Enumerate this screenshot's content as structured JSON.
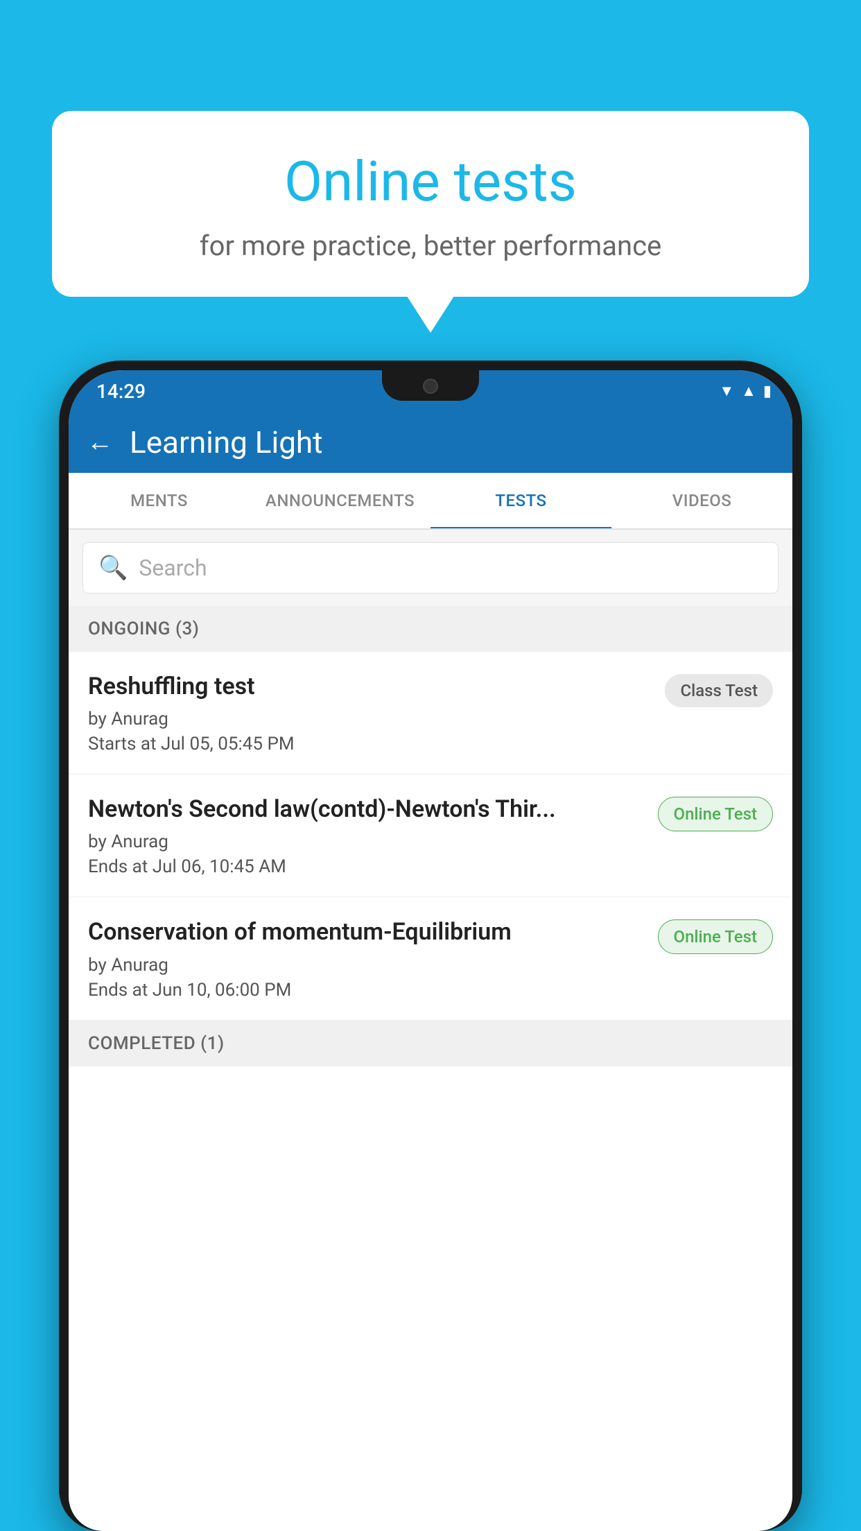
{
  "background_color": "#1bb8e8",
  "speech_bubble": {
    "title": "Online tests",
    "subtitle": "for more practice, better performance"
  },
  "phone": {
    "status_bar": {
      "time": "14:29",
      "icons": [
        "wifi",
        "signal",
        "battery"
      ]
    },
    "header": {
      "back_label": "←",
      "title": "Learning Light"
    },
    "tabs": [
      {
        "label": "MENTS",
        "active": false
      },
      {
        "label": "ANNOUNCEMENTS",
        "active": false
      },
      {
        "label": "TESTS",
        "active": true
      },
      {
        "label": "VIDEOS",
        "active": false
      }
    ],
    "search": {
      "placeholder": "Search"
    },
    "sections": [
      {
        "label": "ONGOING (3)",
        "tests": [
          {
            "title": "Reshuffling test",
            "author": "by Anurag",
            "time": "Starts at  Jul 05, 05:45 PM",
            "badge": "Class Test",
            "badge_type": "class"
          },
          {
            "title": "Newton's Second law(contd)-Newton's Thir...",
            "author": "by Anurag",
            "time": "Ends at  Jul 06, 10:45 AM",
            "badge": "Online Test",
            "badge_type": "online"
          },
          {
            "title": "Conservation of momentum-Equilibrium",
            "author": "by Anurag",
            "time": "Ends at  Jun 10, 06:00 PM",
            "badge": "Online Test",
            "badge_type": "online"
          }
        ]
      },
      {
        "label": "COMPLETED (1)",
        "tests": []
      }
    ]
  }
}
